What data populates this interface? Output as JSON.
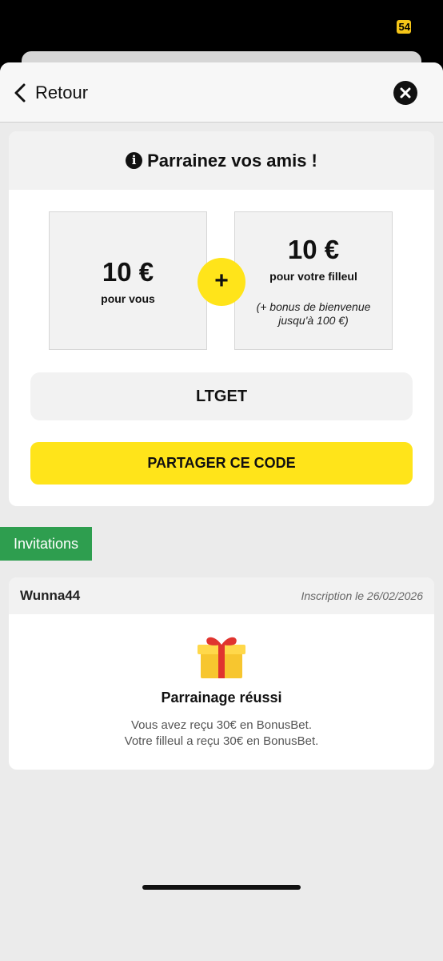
{
  "status": {
    "battery_level": "54"
  },
  "nav": {
    "back_label": "Retour"
  },
  "referral": {
    "title": "Parrainez vos amis !",
    "you_amount": "10 €",
    "you_caption": "pour vous",
    "plus": "+",
    "friend_amount": "10 €",
    "friend_caption": "pour votre filleul",
    "friend_note_line1": "(+ bonus de bienvenue",
    "friend_note_line2": "jusqu'à 100 €)",
    "code": "LTGET",
    "share_label": "PARTAGER CE CODE"
  },
  "invitations": {
    "tab_label": "Invitations",
    "items": [
      {
        "username": "Wunna44",
        "date": "Inscription le 26/02/2026",
        "status_title": "Parrainage réussi",
        "line1": "Vous avez reçu 30€ en BonusBet.",
        "line2": "Votre filleul a reçu 30€ en BonusBet."
      }
    ]
  },
  "colors": {
    "accent": "#ffe41a",
    "green": "#2e9e4f",
    "battery": "#f5c518"
  }
}
